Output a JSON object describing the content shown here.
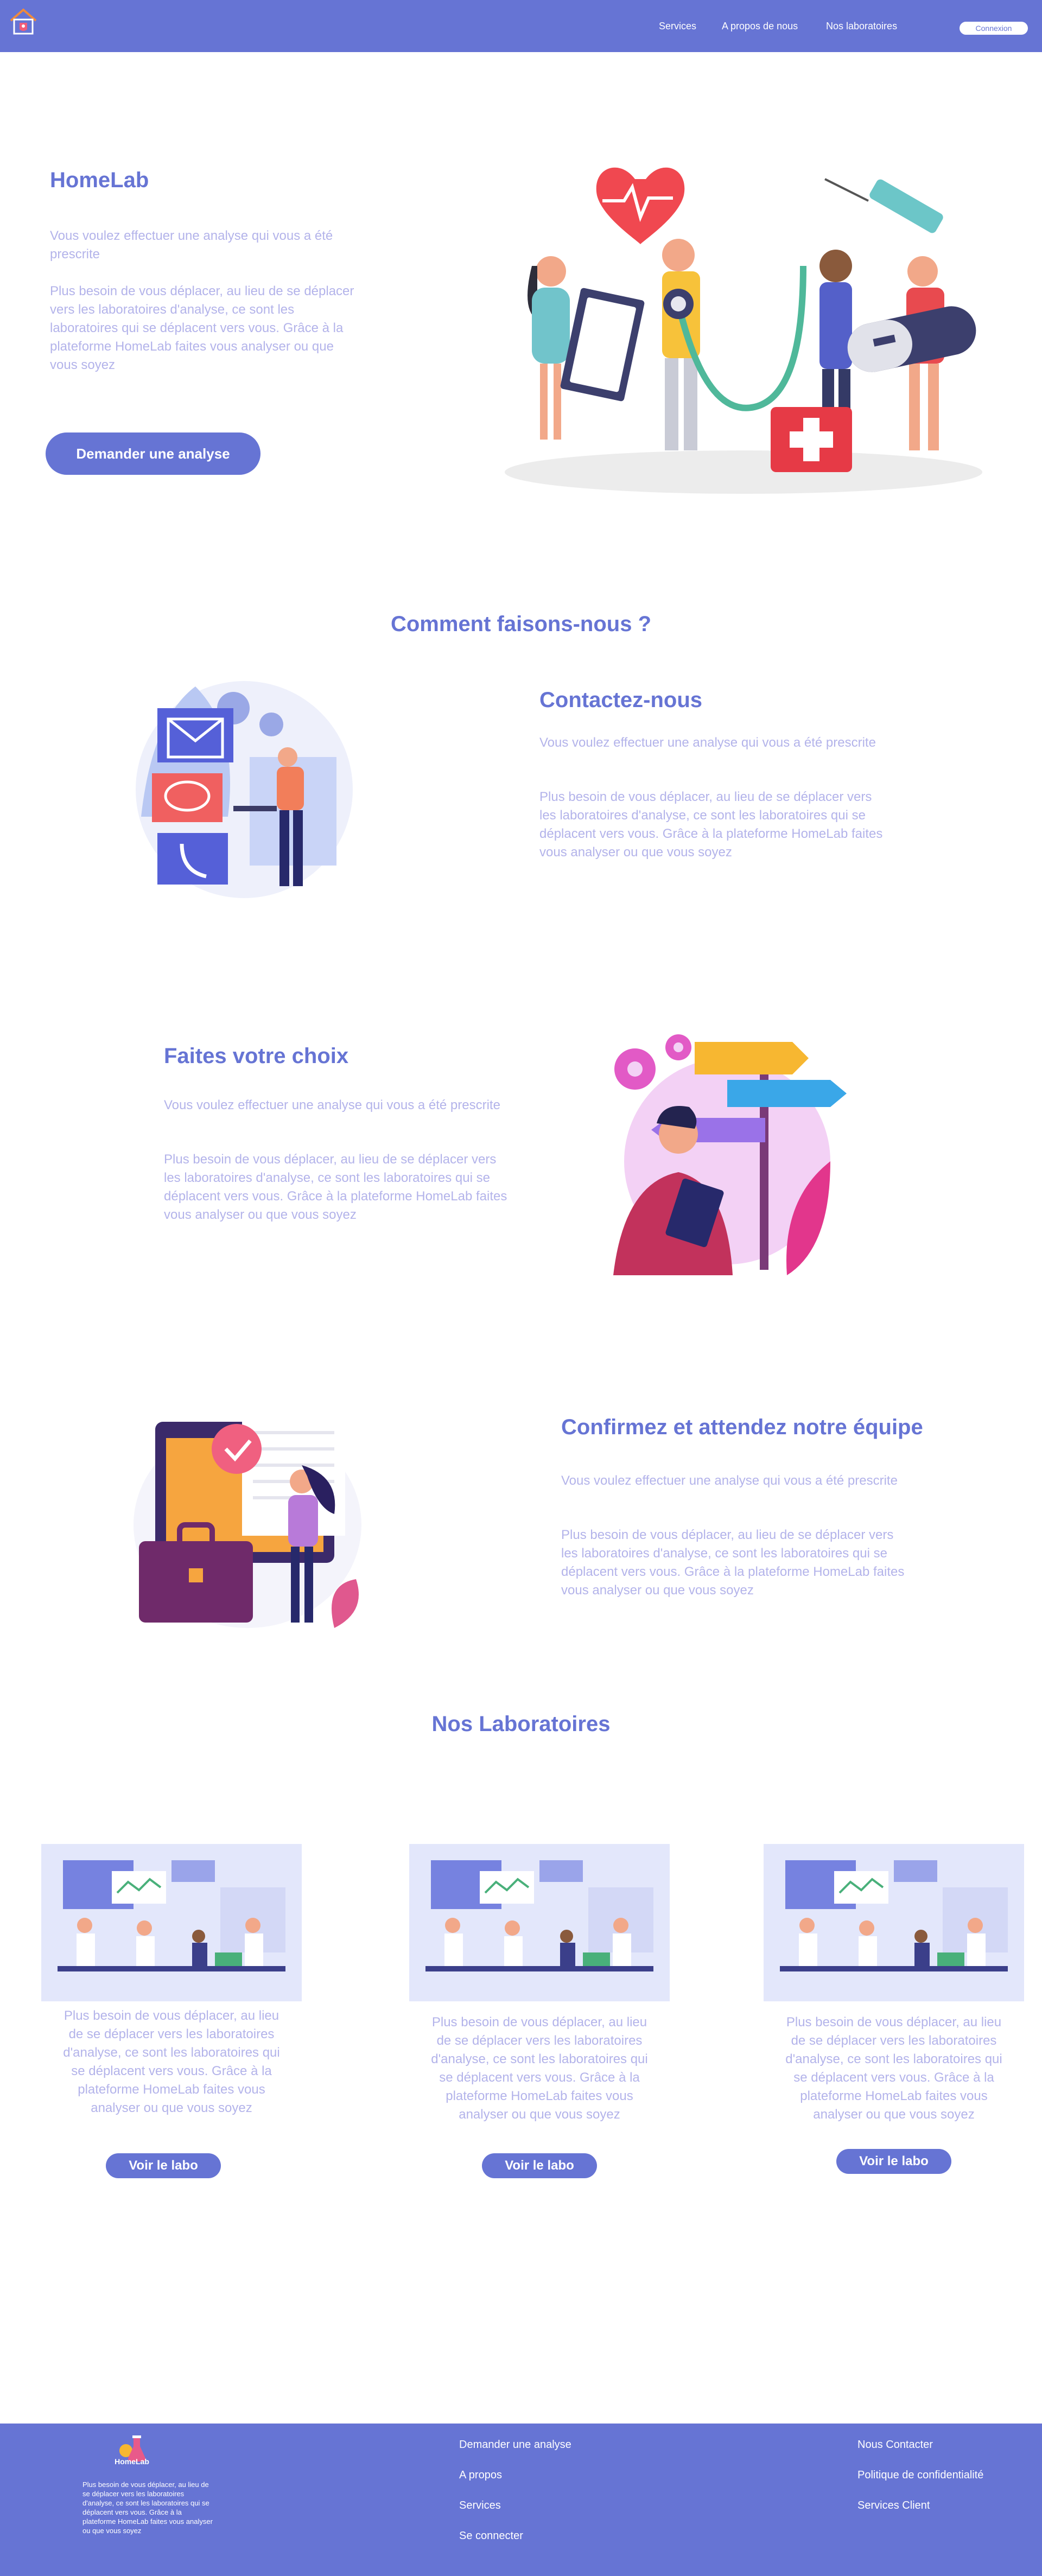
{
  "nav": {
    "links": [
      "Services",
      "A propos de nous",
      "Nos laboratoires"
    ],
    "login": "Connexion"
  },
  "hero": {
    "title": "HomeLab",
    "p1": "Vous voulez effectuer une analyse qui vous a été prescrite",
    "p2": "Plus besoin de vous déplacer, au lieu de se déplacer vers les laboratoires d'analyse, ce sont les laboratoires qui se déplacent vers vous. Grâce à la plateforme HomeLab faites vous analyser ou que vous soyez",
    "cta": "Demander une analyse"
  },
  "how": {
    "title": "Comment faisons-nous ?",
    "steps": [
      {
        "title": "Contactez-nous",
        "p1": "Vous voulez effectuer une analyse qui vous a été prescrite",
        "p2": "Plus besoin de vous déplacer, au lieu de se déplacer vers les laboratoires d'analyse, ce sont les laboratoires qui se déplacent vers vous. Grâce à la plateforme HomeLab faites vous analyser ou que vous soyez"
      },
      {
        "title": "Faites votre choix",
        "p1": "Vous voulez effectuer une analyse qui vous a été prescrite",
        "p2": "Plus besoin de vous déplacer, au lieu de se déplacer vers les laboratoires d'analyse, ce sont les laboratoires qui se déplacent vers vous. Grâce à la plateforme HomeLab faites vous analyser ou que vous soyez"
      },
      {
        "title": "Confirmez et attendez notre équipe",
        "p1": "Vous voulez effectuer une analyse qui vous a été prescrite",
        "p2": "Plus besoin de vous déplacer, au lieu de se déplacer vers les laboratoires d'analyse, ce sont les laboratoires qui se déplacent vers vous. Grâce à la plateforme HomeLab faites vous analyser ou que vous soyez"
      }
    ]
  },
  "labs": {
    "title": "Nos Laboratoires",
    "cards": [
      {
        "text": "Plus besoin de vous déplacer, au lieu de se déplacer vers les laboratoires d'analyse, ce sont les laboratoires qui se déplacent vers vous. Grâce à la plateforme HomeLab faites vous analyser ou que vous soyez",
        "button": "Voir le labo"
      },
      {
        "text": "Plus besoin de vous déplacer, au lieu de se déplacer vers les laboratoires d'analyse, ce sont les laboratoires qui se déplacent vers vous. Grâce à la plateforme HomeLab faites vous analyser ou que vous soyez",
        "button": "Voir le labo"
      },
      {
        "text": "Plus besoin de vous déplacer, au lieu de se déplacer vers les laboratoires d'analyse, ce sont les laboratoires qui se déplacent vers vous. Grâce à la plateforme HomeLab faites vous analyser ou que vous soyez",
        "button": "Voir le labo"
      }
    ]
  },
  "footer": {
    "brand": "HomeLab",
    "desc": "Plus besoin de vous déplacer, au lieu de se déplacer vers les laboratoires d'analyse, ce sont les laboratoires qui se déplacent vers vous. Grâce à la plateforme HomeLab faites vous analyser ou que vous soyez",
    "col1": [
      "Demander une analyse",
      "A propos",
      "Services",
      "Se connecter"
    ],
    "col2": [
      "Nous Contacter",
      "Politique de confidentialité",
      "Services Client"
    ]
  },
  "colors": {
    "primary": "#6674d4",
    "muted_text": "#b3b3ea",
    "background": "#ffffff"
  }
}
